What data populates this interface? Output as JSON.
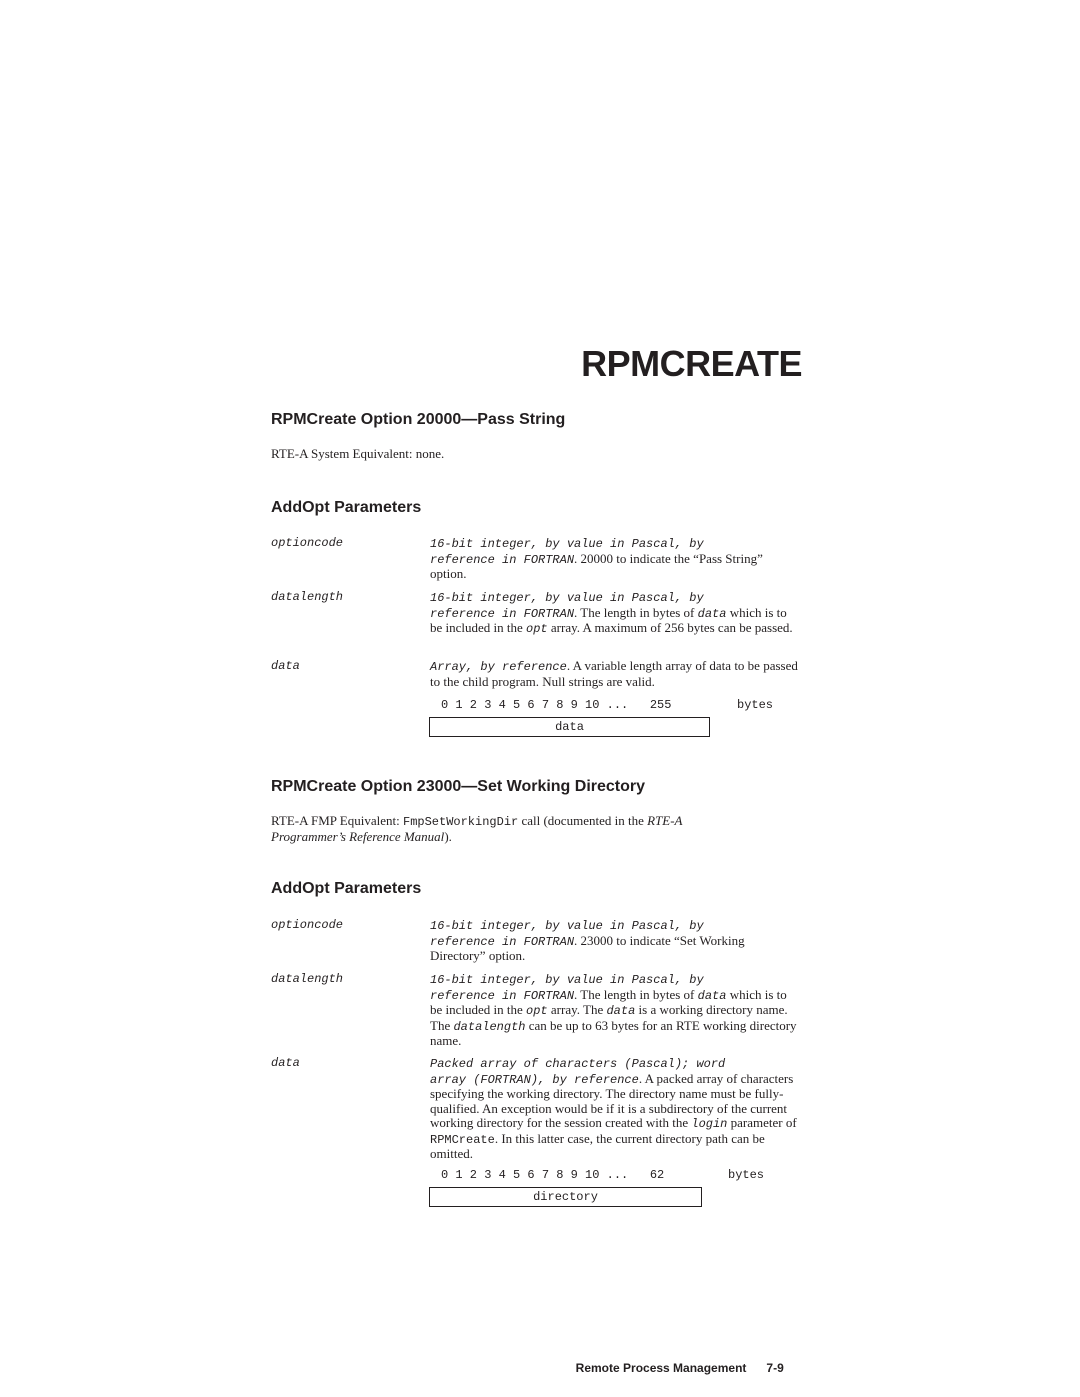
{
  "chapter_title": "RPMCREATE",
  "sections": [
    {
      "heading": "RPMCreate Option 20000—Pass String",
      "equivalent": "RTE-A System Equivalent:  none.",
      "params_heading": "AddOpt Parameters",
      "params": [
        {
          "name": "optioncode",
          "type_line1": "16-bit integer, by value in Pascal, by",
          "type_line2": "reference in FORTRAN",
          "desc": ". 20000 to indicate the “Pass String” option."
        },
        {
          "name": "datalength",
          "type_line1": "16-bit integer, by value in Pascal, by",
          "type_line2": "reference in FORTRAN",
          "desc_a": ". The length in bytes of ",
          "desc_code1": "data",
          "desc_b": " which is to be included in the ",
          "desc_code2": "opt",
          "desc_c": " array.  A maximum of 256 bytes can be passed."
        },
        {
          "name": "data",
          "type_line1": "Array, by reference",
          "desc": ". A variable length array of data to be passed to the child program.  Null strings are valid."
        }
      ],
      "byte_diagram": {
        "scale": "0 1 2 3 4 5 6 7 8 9 10 ...   255",
        "unit": "bytes",
        "field": "data"
      }
    },
    {
      "heading": "RPMCreate Option 23000—Set Working Directory",
      "equivalent_prefix": "RTE-A FMP Equivalent:  ",
      "equivalent_code": "FmpSetWorkingDir",
      "equivalent_mid": " call (documented in the ",
      "equivalent_ref_line1": "RTE-A",
      "equivalent_ref_line2": "Programmer’s Reference Manual",
      "equivalent_suffix": ").",
      "params_heading": "AddOpt Parameters",
      "params": [
        {
          "name": "optioncode",
          "type_line1": "16-bit integer, by value in Pascal, by",
          "type_line2": "reference in FORTRAN",
          "desc": ". 23000 to indicate “Set Working Directory” option."
        },
        {
          "name": "datalength",
          "type_line1": "16-bit integer, by value in Pascal, by",
          "type_line2": "reference in FORTRAN",
          "desc_a": ". The length in bytes of ",
          "desc_code1": "data",
          "desc_b": " which is to be included in the ",
          "desc_code2": "opt",
          "desc_c": " array.  The ",
          "desc_code3": "data",
          "desc_d": " is a working directory name.  The ",
          "desc_code4": "datalength",
          "desc_e": " can be up to 63 bytes for an RTE working directory name."
        },
        {
          "name": "data",
          "type_line1": "Packed array of characters (Pascal); word",
          "type_line2": "array (FORTRAN), by reference",
          "desc_a": ". A packed array of characters specifying the working directory.  The directory name must be fully-qualified.  An exception would be if it is a subdirectory of the current working directory for the session created with the ",
          "desc_code1": "login",
          "desc_b": " parameter of ",
          "desc_code2": "RPMCreate",
          "desc_c": ".  In this latter case, the current directory path can be omitted."
        }
      ],
      "byte_diagram": {
        "scale": "0 1 2 3 4 5 6 7 8 9 10 ...   62",
        "unit": "bytes",
        "field": "directory"
      }
    }
  ],
  "footer": {
    "section_name": "Remote Process Management",
    "page_number": "7-9"
  }
}
